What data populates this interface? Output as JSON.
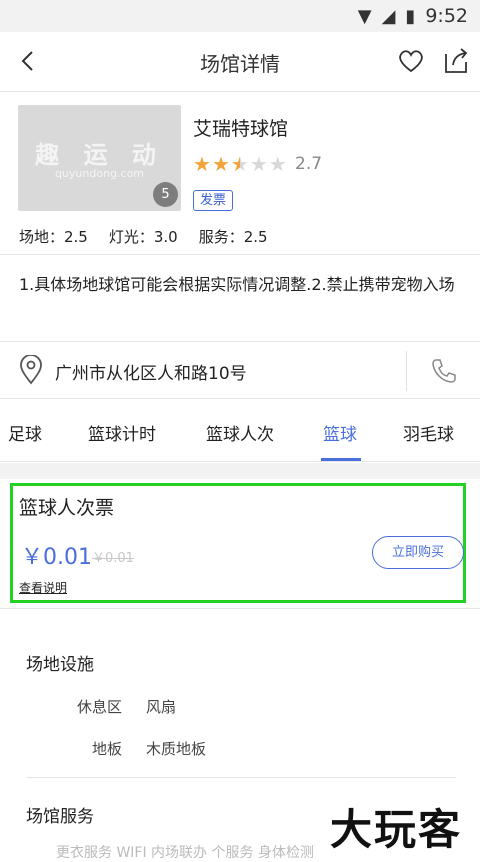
{
  "status_bar": {
    "time": "9:52"
  },
  "header": {
    "title": "场馆详情"
  },
  "venue": {
    "thumbnail_logo": "趣 运 动",
    "thumbnail_sub": "quyundong.com",
    "photo_count": "5",
    "name": "艾瑞特球馆",
    "rating": "2.7",
    "stars_filled": 2.5,
    "stars_total": 5,
    "invoice_label": "发票",
    "scores": {
      "field": "场地：2.5",
      "lighting": "灯光：3.0",
      "service": "服务：2.5"
    }
  },
  "notice": "1.具体场地球馆可能会根据实际情况调整.2.禁止携带宠物入场",
  "address": "广州市从化区人和路10号",
  "tabs": [
    {
      "label": "足球"
    },
    {
      "label": "篮球计时"
    },
    {
      "label": "篮球人次"
    },
    {
      "label": "篮球",
      "active": true
    },
    {
      "label": "羽毛球"
    }
  ],
  "ticket": {
    "name": "篮球人次票",
    "price": "￥0.01",
    "original_price": "￥0.01",
    "buy_label": "立即购买",
    "desc_link": "查看说明"
  },
  "facilities": {
    "heading": "场地设施",
    "rows": [
      {
        "label": "休息区",
        "value": "风扇"
      },
      {
        "label": "地板",
        "value": "木质地板"
      }
    ]
  },
  "services": {
    "heading": "场馆服务",
    "cut_text": "更衣服务   WIFI   内场联办   个服务   身体检测"
  },
  "watermark": "大玩客",
  "colors": {
    "accent": "#4a6fdc",
    "highlight": "#22d122",
    "star": "#f2a33a"
  }
}
